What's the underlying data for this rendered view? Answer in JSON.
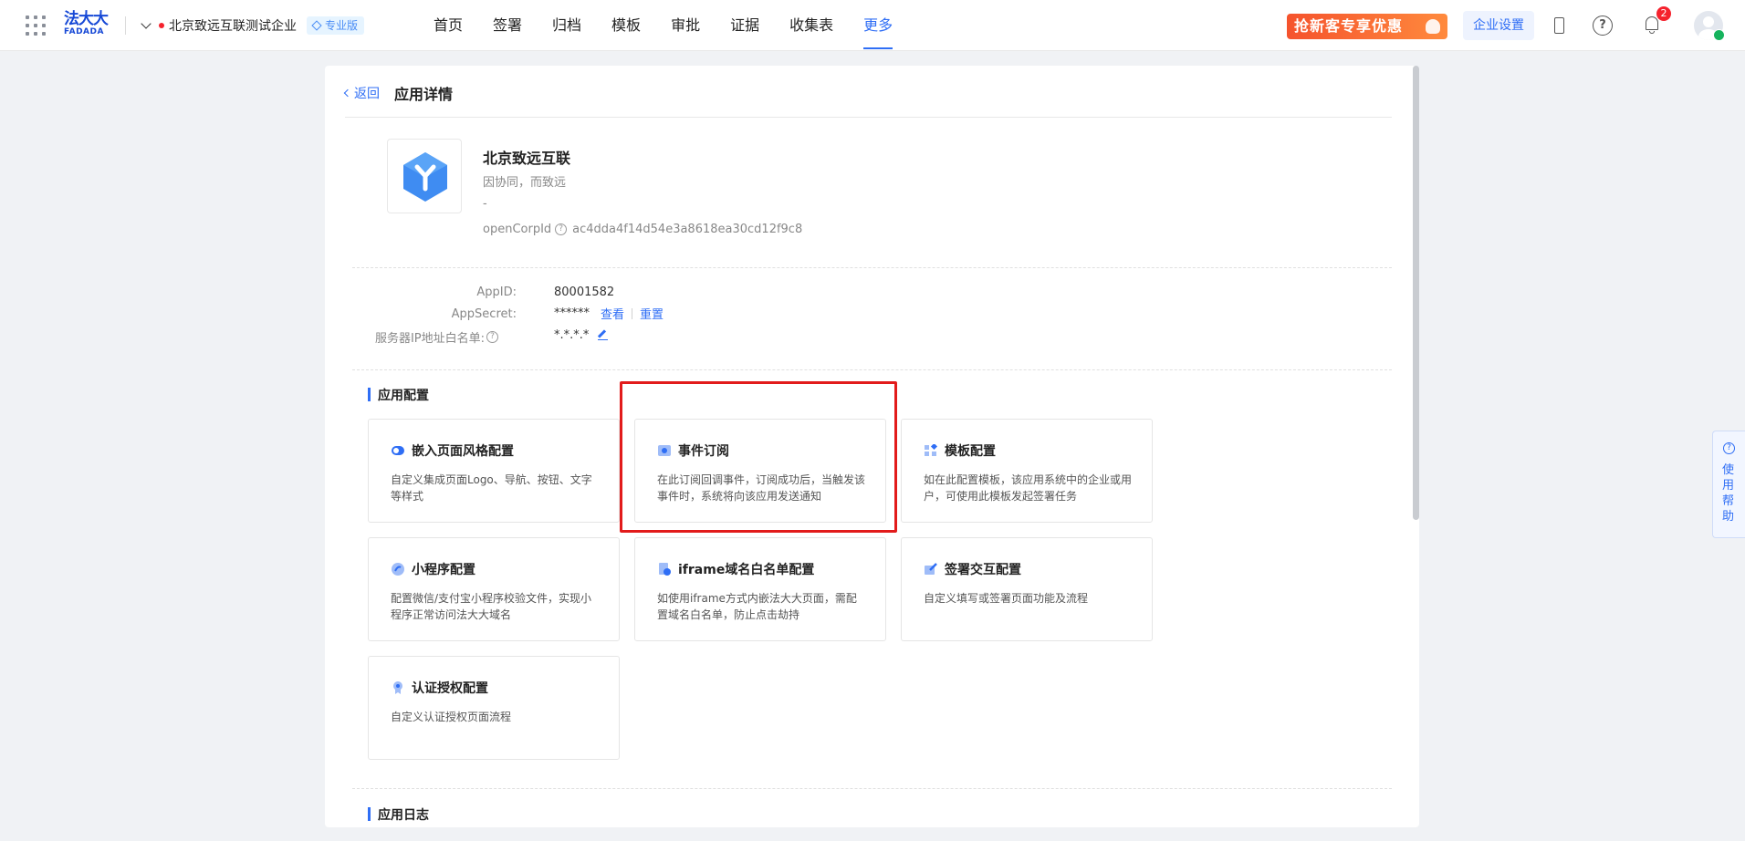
{
  "topbar": {
    "logo_cn": "法大大",
    "logo_en": "FADADA",
    "company_name": "北京致远互联测试企业",
    "edition_badge": "专业版",
    "nav": [
      {
        "label": "首页",
        "active": false
      },
      {
        "label": "签署",
        "active": false
      },
      {
        "label": "归档",
        "active": false
      },
      {
        "label": "模板",
        "active": false
      },
      {
        "label": "审批",
        "active": false
      },
      {
        "label": "证据",
        "active": false
      },
      {
        "label": "收集表",
        "active": false
      },
      {
        "label": "更多",
        "active": true
      }
    ],
    "promo_text": "抢新客专享优惠",
    "enterprise_settings": "企业设置",
    "notification_count": "2"
  },
  "detail": {
    "back_label": "返回",
    "title": "应用详情",
    "app_name": "北京致远互联",
    "app_desc": "因协同，而致远",
    "app_extra": "-",
    "open_corp_label": "openCorpId",
    "open_corp_value": "ac4dda4f14d54e3a8618ea30cd12f9c8"
  },
  "credentials": {
    "appid_label": "AppID:",
    "appid_value": "80001582",
    "secret_label": "AppSecret:",
    "secret_value": "******",
    "view_link": "查看",
    "reset_link": "重置",
    "ip_label": "服务器IP地址白名单:",
    "ip_value": "*.*.*.*"
  },
  "app_config": {
    "section_title": "应用配置",
    "items": [
      {
        "title": "嵌入页面风格配置",
        "desc": "自定义集成页面Logo、导航、按钮、文字等样式",
        "icon": "embed-style-icon"
      },
      {
        "title": "事件订阅",
        "desc": "在此订阅回调事件，订阅成功后，当触发该事件时，系统将向该应用发送通知",
        "icon": "event-subscribe-icon"
      },
      {
        "title": "模板配置",
        "desc": "如在此配置模板，该应用系统中的企业或用户，可使用此模板发起签署任务",
        "icon": "template-config-icon"
      },
      {
        "title": "小程序配置",
        "desc": "配置微信/支付宝小程序校验文件，实现小程序正常访问法大大域名",
        "icon": "miniprogram-icon"
      },
      {
        "title": "iframe域名白名单配置",
        "desc": "如使用iframe方式内嵌法大大页面，需配置域名白名单，防止点击劫持",
        "icon": "iframe-whitelist-icon"
      },
      {
        "title": "签署交互配置",
        "desc": "自定义填写或签署页面功能及流程",
        "icon": "sign-interaction-icon"
      },
      {
        "title": "认证授权配置",
        "desc": "自定义认证授权页面流程",
        "icon": "auth-config-icon"
      }
    ]
  },
  "app_log": {
    "section_title": "应用日志"
  },
  "side_help": {
    "label": "使用帮助"
  },
  "colors": {
    "accent": "#2f6ef5",
    "highlight": "#e21b1b",
    "promo": "#f5532d"
  }
}
